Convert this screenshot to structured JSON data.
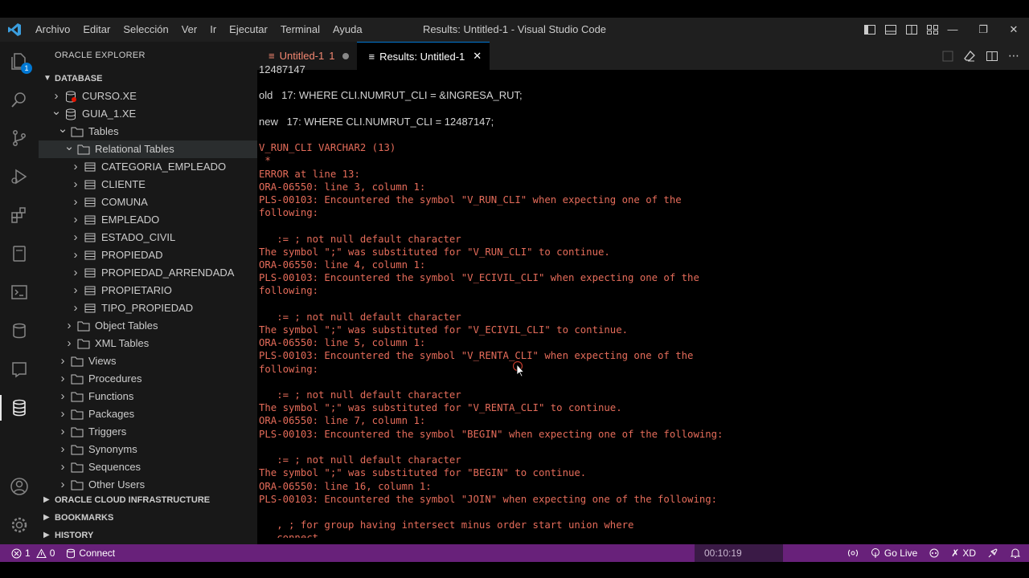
{
  "app": {
    "window_title": "Results: Untitled-1 - Visual Studio Code",
    "menu": [
      "Archivo",
      "Editar",
      "Selección",
      "Ver",
      "Ir",
      "Ejecutar",
      "Terminal",
      "Ayuda"
    ]
  },
  "activity_bar": {
    "explorer_badge": "1"
  },
  "sidebar": {
    "title": "ORACLE EXPLORER",
    "database_section": "DATABASE",
    "connections": [
      {
        "label": "CURSO.XE"
      },
      {
        "label": "GUIA_1.XE"
      }
    ],
    "tables_label": "Tables",
    "relational_tables_label": "Relational Tables",
    "tables": [
      "CATEGORIA_EMPLEADO",
      "CLIENTE",
      "COMUNA",
      "EMPLEADO",
      "ESTADO_CIVIL",
      "PROPIEDAD",
      "PROPIEDAD_ARRENDADA",
      "PROPIETARIO",
      "TIPO_PROPIEDAD"
    ],
    "object_tables_label": "Object Tables",
    "xml_tables_label": "XML Tables",
    "folders": [
      "Views",
      "Procedures",
      "Functions",
      "Packages",
      "Triggers",
      "Synonyms",
      "Sequences",
      "Other Users"
    ],
    "oci_section": "ORACLE CLOUD INFRASTRUCTURE",
    "bookmarks_section": "BOOKMARKS",
    "history_section": "HISTORY"
  },
  "tabs": [
    {
      "label": "Untitled-1",
      "suffix": "1",
      "state": "modified"
    },
    {
      "label": "Results: Untitled-1",
      "state": "active"
    }
  ],
  "output": {
    "lines": [
      {
        "text": "12487147",
        "style": "sans"
      },
      {
        "text": "",
        "style": "sans"
      },
      {
        "text": "old   17: WHERE CLI.NUMRUT_CLI = &INGRESA_RUT;",
        "style": "sans"
      },
      {
        "text": "",
        "style": "sans"
      },
      {
        "text": "new   17: WHERE CLI.NUMRUT_CLI = 12487147;",
        "style": "sans"
      },
      {
        "text": "",
        "style": "sans"
      },
      {
        "text": "V_RUN_CLI VARCHAR2 (13)",
        "style": "mono"
      },
      {
        "text": " *",
        "style": "mono"
      },
      {
        "text": "ERROR at line 13:",
        "style": "mono"
      },
      {
        "text": "ORA-06550: line 3, column 1:",
        "style": "mono"
      },
      {
        "text": "PLS-00103: Encountered the symbol \"V_RUN_CLI\" when expecting one of the",
        "style": "mono"
      },
      {
        "text": "following:",
        "style": "mono"
      },
      {
        "text": "",
        "style": "mono"
      },
      {
        "text": "   := ; not null default character",
        "style": "mono"
      },
      {
        "text": "The symbol \";\" was substituted for \"V_RUN_CLI\" to continue.",
        "style": "mono"
      },
      {
        "text": "ORA-06550: line 4, column 1:",
        "style": "mono"
      },
      {
        "text": "PLS-00103: Encountered the symbol \"V_ECIVIL_CLI\" when expecting one of the",
        "style": "mono"
      },
      {
        "text": "following:",
        "style": "mono"
      },
      {
        "text": "",
        "style": "mono"
      },
      {
        "text": "   := ; not null default character",
        "style": "mono"
      },
      {
        "text": "The symbol \";\" was substituted for \"V_ECIVIL_CLI\" to continue.",
        "style": "mono"
      },
      {
        "text": "ORA-06550: line 5, column 1:",
        "style": "mono"
      },
      {
        "text": "PLS-00103: Encountered the symbol \"V_RENTA_CLI\" when expecting one of the",
        "style": "mono"
      },
      {
        "text": "following:",
        "style": "mono"
      },
      {
        "text": "",
        "style": "mono"
      },
      {
        "text": "   := ; not null default character",
        "style": "mono"
      },
      {
        "text": "The symbol \";\" was substituted for \"V_RENTA_CLI\" to continue.",
        "style": "mono"
      },
      {
        "text": "ORA-06550: line 7, column 1:",
        "style": "mono"
      },
      {
        "text": "PLS-00103: Encountered the symbol \"BEGIN\" when expecting one of the following:",
        "style": "mono"
      },
      {
        "text": "",
        "style": "mono"
      },
      {
        "text": "   := ; not null default character",
        "style": "mono"
      },
      {
        "text": "The symbol \";\" was substituted for \"BEGIN\" to continue.",
        "style": "mono"
      },
      {
        "text": "ORA-06550: line 16, column 1:",
        "style": "mono"
      },
      {
        "text": "PLS-00103: Encountered the symbol \"JOIN\" when expecting one of the following:",
        "style": "mono"
      },
      {
        "text": "",
        "style": "mono"
      },
      {
        "text": "   , ; for group having intersect minus order start union where",
        "style": "mono"
      },
      {
        "text": "   connect",
        "style": "mono"
      }
    ]
  },
  "statusbar": {
    "errors": "1",
    "warnings": "0",
    "connect_label": "Connect",
    "timer": "00:10:19",
    "go_live": "Go Live",
    "xd": "XD"
  },
  "colors": {
    "statusbar": "#68217a",
    "output_text": "#e56c5a",
    "accent": "#0078d4"
  }
}
